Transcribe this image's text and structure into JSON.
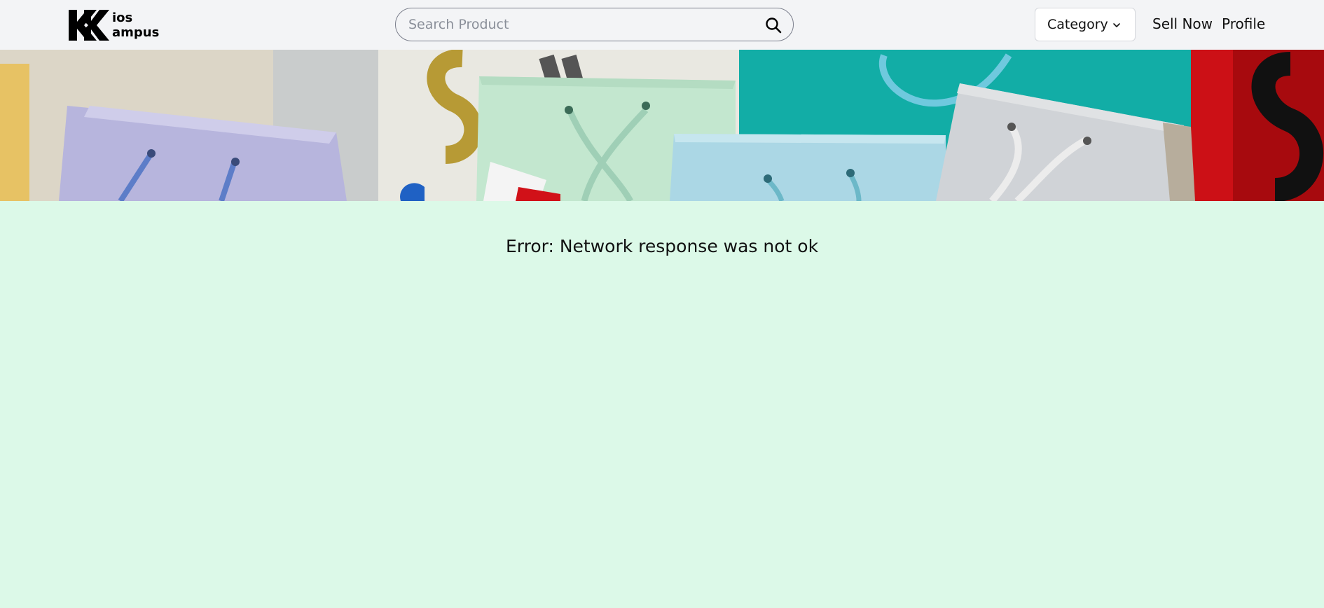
{
  "header": {
    "logo": {
      "line1": "ios",
      "line2": "ampus",
      "icon": "kk-logo-icon"
    },
    "search": {
      "placeholder": "Search Product",
      "value": "",
      "icon": "search-icon"
    },
    "category": {
      "label": "Category",
      "icon": "chevron-down-icon"
    },
    "nav": {
      "sell_now": "Sell Now",
      "profile": "Profile"
    }
  },
  "banner": {
    "image": "shopping-bags-sale-banner",
    "colors": {
      "purple_bag": "#b6b3dc",
      "green_bag": "#c2e6cf",
      "blue_bag": "#a9d6e4",
      "grey_bag": "#cfd2d6",
      "teal_wall": "#10aaa3",
      "red_wall": "#cf1016",
      "yellow_bag": "#e8c468"
    }
  },
  "main": {
    "error": "Error: Network response was not ok",
    "background": "#dcf9e8"
  }
}
